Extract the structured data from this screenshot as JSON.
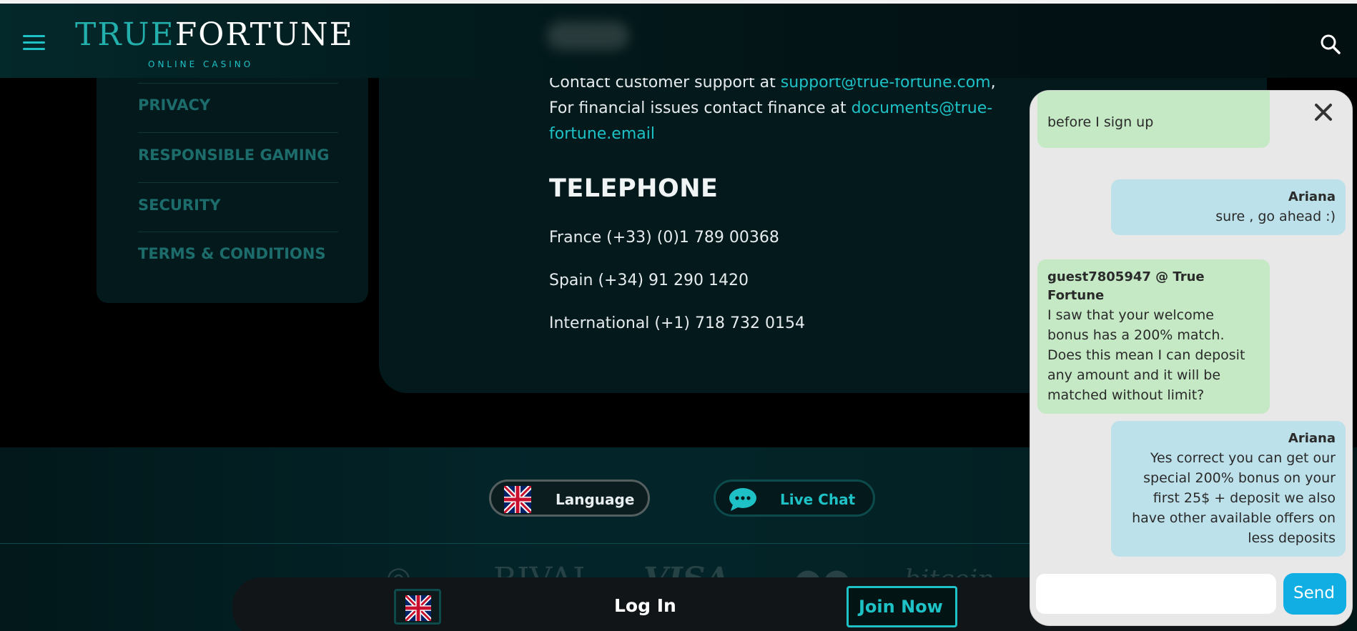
{
  "header": {
    "logo_true": "TRUE",
    "logo_fortune": "FORTUNE",
    "logo_sub": "ONLINE CASINO"
  },
  "side_menu": {
    "items": [
      {
        "label": "PRIVACY"
      },
      {
        "label": "RESPONSIBLE GAMING"
      },
      {
        "label": "SECURITY"
      },
      {
        "label": "TERMS & CONDITIONS"
      }
    ]
  },
  "contact": {
    "support_prefix": "Contact customer support at ",
    "support_email": "support@true-fortune.com",
    "support_suffix": ",",
    "finance_prefix": "For financial issues contact finance at ",
    "finance_email_part1": "documents@true-",
    "finance_email_part2": "fortune.email",
    "telephone_heading": "TELEPHONE",
    "phones": [
      "France (+33) (0)1 789 00368",
      "Spain (+34) 91 290 1420",
      "International (+1) 718 732 0154"
    ]
  },
  "footer": {
    "language_label": "Language",
    "live_chat_label": "Live Chat",
    "payment_logos": [
      "RIVAL",
      "VISA",
      "bitcoin"
    ]
  },
  "bottom_bar": {
    "login_label": "Log In",
    "join_label": "Join Now"
  },
  "chat": {
    "messages": [
      {
        "role": "guest",
        "sender": "",
        "text": "before I sign up"
      },
      {
        "role": "agent",
        "sender": "Ariana",
        "text": "sure , go ahead :)"
      },
      {
        "role": "guest",
        "sender": "guest7805947 @ True Fortune",
        "text": "I saw that your welcome\nbonus has a 200% match.\nDoes this mean I can deposit\nany amount and it will be\nmatched without limit?"
      },
      {
        "role": "agent",
        "sender": "Ariana",
        "text": "Yes correct you can get our\nspecial 200% bonus on your\nfirst 25$ + deposit we also\nhave other available offers on\nless deposits"
      }
    ],
    "input_value": "",
    "send_label": "Send"
  },
  "colors": {
    "accent": "#1ec2c6",
    "guest_bubble": "#c4e9c4",
    "agent_bubble": "#bde1ea",
    "send_button": "#10aee2"
  }
}
